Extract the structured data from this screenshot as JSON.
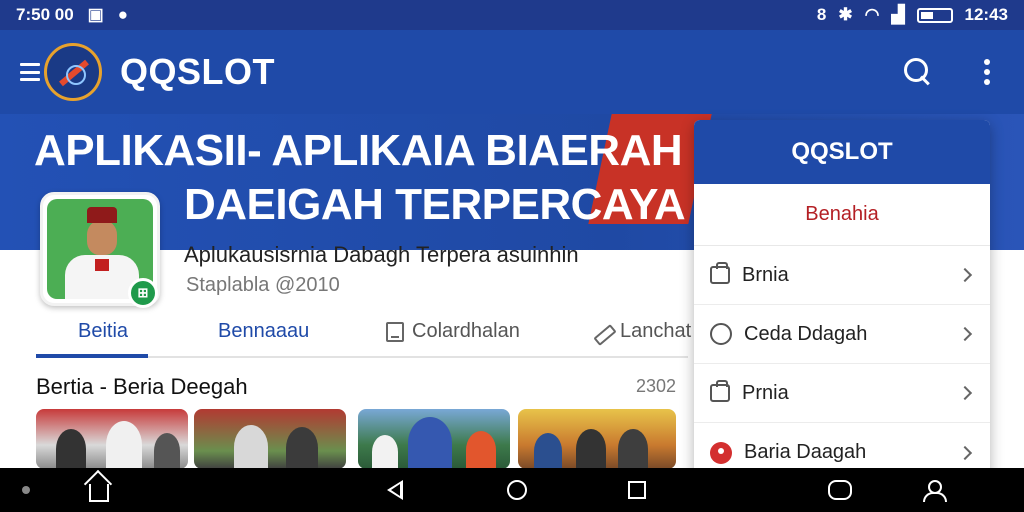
{
  "status_bar": {
    "time": "7:50 00",
    "right_time": "12:43"
  },
  "app_bar": {
    "title": "QQSLOT",
    "icons": [
      "menu-icon",
      "logo",
      "search-icon",
      "kebab-menu-icon"
    ]
  },
  "hero": {
    "line1": "APLIKASII- APLIKAIA BIAERAH",
    "line2": "DAEIGAH TERPERCAYA"
  },
  "profile": {
    "name": "Aplukausisrnia Dabagh Terpera asuinhin",
    "subtitle": "Staplabla @2010"
  },
  "tabs": [
    {
      "label": "Beitia",
      "active": true
    },
    {
      "label": "Bennaaau",
      "active": false
    },
    {
      "label": "Colardhalan",
      "active": false
    },
    {
      "label": "Lanchat",
      "active": false
    }
  ],
  "section": {
    "title": "Bertia - Beria Deegah",
    "count": "2302"
  },
  "dropdown": {
    "header": "QQSLOT",
    "highlight": "Benahia",
    "items": [
      {
        "label": "Brnia",
        "icon": "bag-icon"
      },
      {
        "label": "Ceda Ddagah",
        "icon": "chat-icon"
      },
      {
        "label": "Prnia",
        "icon": "bag-icon"
      },
      {
        "label": "Baria Daagah",
        "icon": "pin-icon"
      }
    ]
  },
  "colors": {
    "primary": "#1f4aa8",
    "status_bar": "#1f3a8c",
    "accent_red": "#b41f24"
  }
}
